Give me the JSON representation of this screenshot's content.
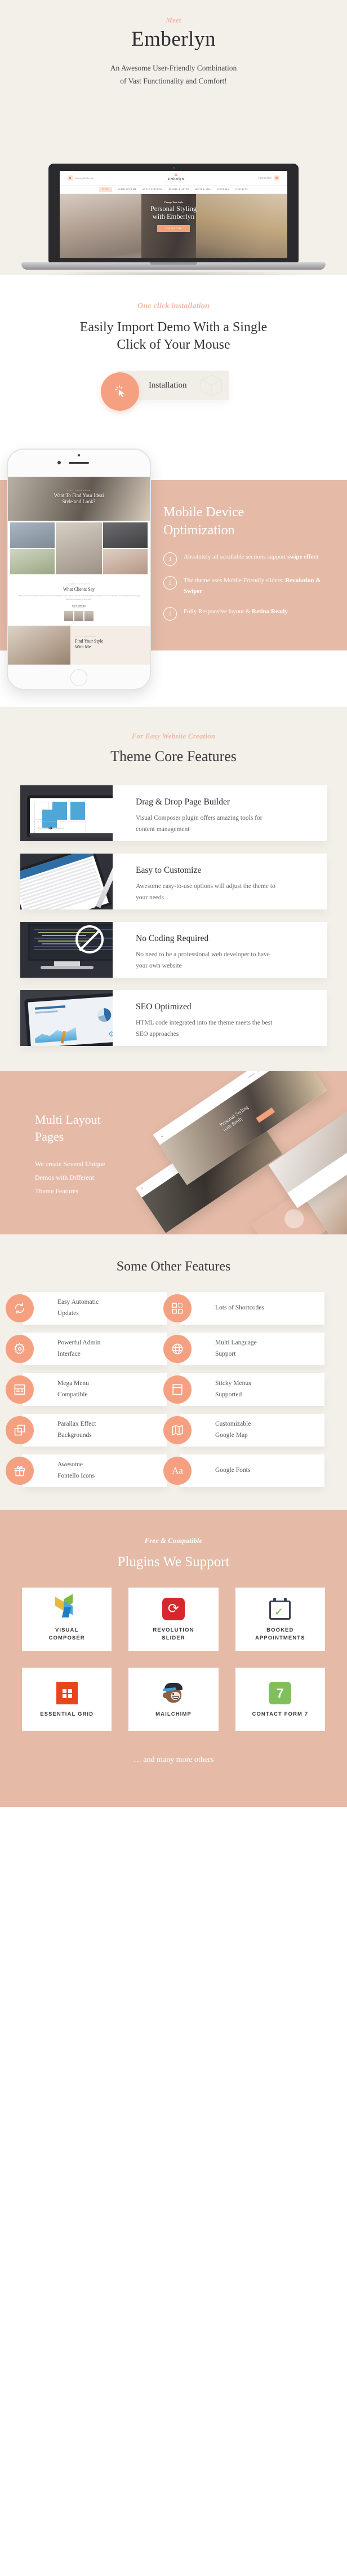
{
  "hero": {
    "eyebrow": "Meet",
    "title": "Emberlyn",
    "subtitle_line1": "An Awesome User-Friendly Combination",
    "subtitle_line2": "of Vast Functionality  and Comfort!",
    "mockup": {
      "email": "emberlyn@info.com",
      "phone": "0 800 668 88 65",
      "logo_name": "Emberlyn",
      "logo_tagline": "PERSONAL STYLIST",
      "nav": [
        "HOME",
        "WORK WITH ME",
        "STYLE SERVICES",
        "BEFORE & AFTER",
        "HINTS & TIPS",
        "FEATURES",
        "CONTACTS"
      ],
      "slide_kicker": "Change Your Style",
      "slide_title_line1": "Personal Styling",
      "slide_title_line2": "with Emberlyn",
      "slide_button": "CONTACT ME"
    }
  },
  "install": {
    "eyebrow": "One click installation",
    "title_line1": "Easily Import Demo With a Single",
    "title_line2": "Click of Your Mouse",
    "button_label": "Installation",
    "cursor_icon": "click-cursor-icon",
    "box_icon": "package-box-icon"
  },
  "mobile": {
    "title_line1": "Mobile Device",
    "title_line2": "Optimization",
    "items": [
      {
        "num": "1",
        "text_plain": "Absolutely all scrollable sections support ",
        "text_bold": "swipe effect"
      },
      {
        "num": "2",
        "text_plain": "The theme uses Mobile Friendly sliders: ",
        "text_bold": "Revolution & Swiper"
      },
      {
        "num": "3",
        "text_plain": "Fully Responsive layout & ",
        "text_bold": "Retina Ready"
      }
    ],
    "phone_preview": {
      "hero_kicker": "FIND YOUR LOOK",
      "hero_title_line1": "Want To Find Your Ideal",
      "hero_title_line2": "Style and Look?",
      "testimonial_kicker": "CLIENTS REVIEWS",
      "testimonial_title": "What Clients Say",
      "testimonial_text": "\"After well researched from a business owner and looking for another release, I found it extremely different collections, more relaxed style while enjoying that one myself and others that helps me with that.\"",
      "testimonial_name": "Lucy Montags",
      "testimonial_role": "MY CLIENT",
      "bottom_kicker": "STYLE CONSULTING",
      "bottom_title_line1": "Find Your Style",
      "bottom_title_line2": "With Me"
    }
  },
  "core": {
    "eyebrow": "For Easy Website Creation",
    "title": "Theme Core Features",
    "cards": [
      {
        "title": "Drag & Drop Page Builder",
        "desc": "Visual Composer plugin offers amazing tools for content management",
        "thumb_caption": "Drag here to add widgets"
      },
      {
        "title": "Easy to Customize",
        "desc": "Awesome easy-to-use options will adjust the theme to your needs",
        "thumb_caption": ""
      },
      {
        "title": "No Coding Required",
        "desc": "No need to be a professional web developer to have your own website",
        "thumb_caption": ""
      },
      {
        "title": "SEO Optimized",
        "desc": "HTML code integrated into the theme meets the best SEO approaches",
        "thumb_caption": ""
      }
    ]
  },
  "multi": {
    "title_line1": "Multi Layout",
    "title_line2": "Pages",
    "desc_line1": "We create Several Unique",
    "desc_line2": "Demos with Different",
    "desc_line3": "Theme Features"
  },
  "other": {
    "title": "Some Other Features",
    "cards": [
      {
        "icon": "refresh-icon",
        "line1": "Easy Automatic",
        "line2": "Updates"
      },
      {
        "icon": "grid-blocks-icon",
        "line1": "Lots of Shortcodes",
        "line2": ""
      },
      {
        "icon": "gear-icon",
        "line1": "Powerful Admin",
        "line2": "Interface"
      },
      {
        "icon": "globe-icon",
        "line1": "Multi Language",
        "line2": "Support"
      },
      {
        "icon": "mega-menu-icon",
        "line1": "Mega Menu",
        "line2": "Compatible"
      },
      {
        "icon": "sticky-menu-icon",
        "line1": "Sticky Menus",
        "line2": "Supported"
      },
      {
        "icon": "layers-icon",
        "line1": "Parallax Effect",
        "line2": "Backgrounds"
      },
      {
        "icon": "map-icon",
        "line1": "Customizable",
        "line2": "Google Map"
      },
      {
        "icon": "gift-icon",
        "line1": "Awesome",
        "line2": "Fontello Icons"
      },
      {
        "icon": "typography-aa-icon",
        "line1": "Google Fonts",
        "line2": ""
      }
    ]
  },
  "plugins": {
    "eyebrow": "Free & Compatible",
    "title": "Plugins We Support",
    "items": [
      {
        "icon": "visual-composer-logo",
        "line1": "VISUAL",
        "line2": "COMPOSER"
      },
      {
        "icon": "revolution-slider-logo",
        "line1": "REVOLUTION",
        "line2": "SLIDER"
      },
      {
        "icon": "booked-appointments-logo",
        "line1": "BOOKED",
        "line2": "APPOINTMENTS"
      },
      {
        "icon": "essential-grid-logo",
        "line1": "ESSENTIAL GRID",
        "line2": ""
      },
      {
        "icon": "mailchimp-logo",
        "line1": "MAILCHIMP",
        "line2": ""
      },
      {
        "icon": "contact-form-7-logo",
        "line1": "CONTACT FORM 7",
        "line2": ""
      }
    ],
    "footer_note": "… and many more others"
  },
  "colors": {
    "background_beige": "#F3F0EA",
    "band_salmon": "#E5BBA8",
    "accent_orange": "#F5A181",
    "eyebrow_pink": "#EEB9A3",
    "heading_dark": "#2E2E32"
  }
}
